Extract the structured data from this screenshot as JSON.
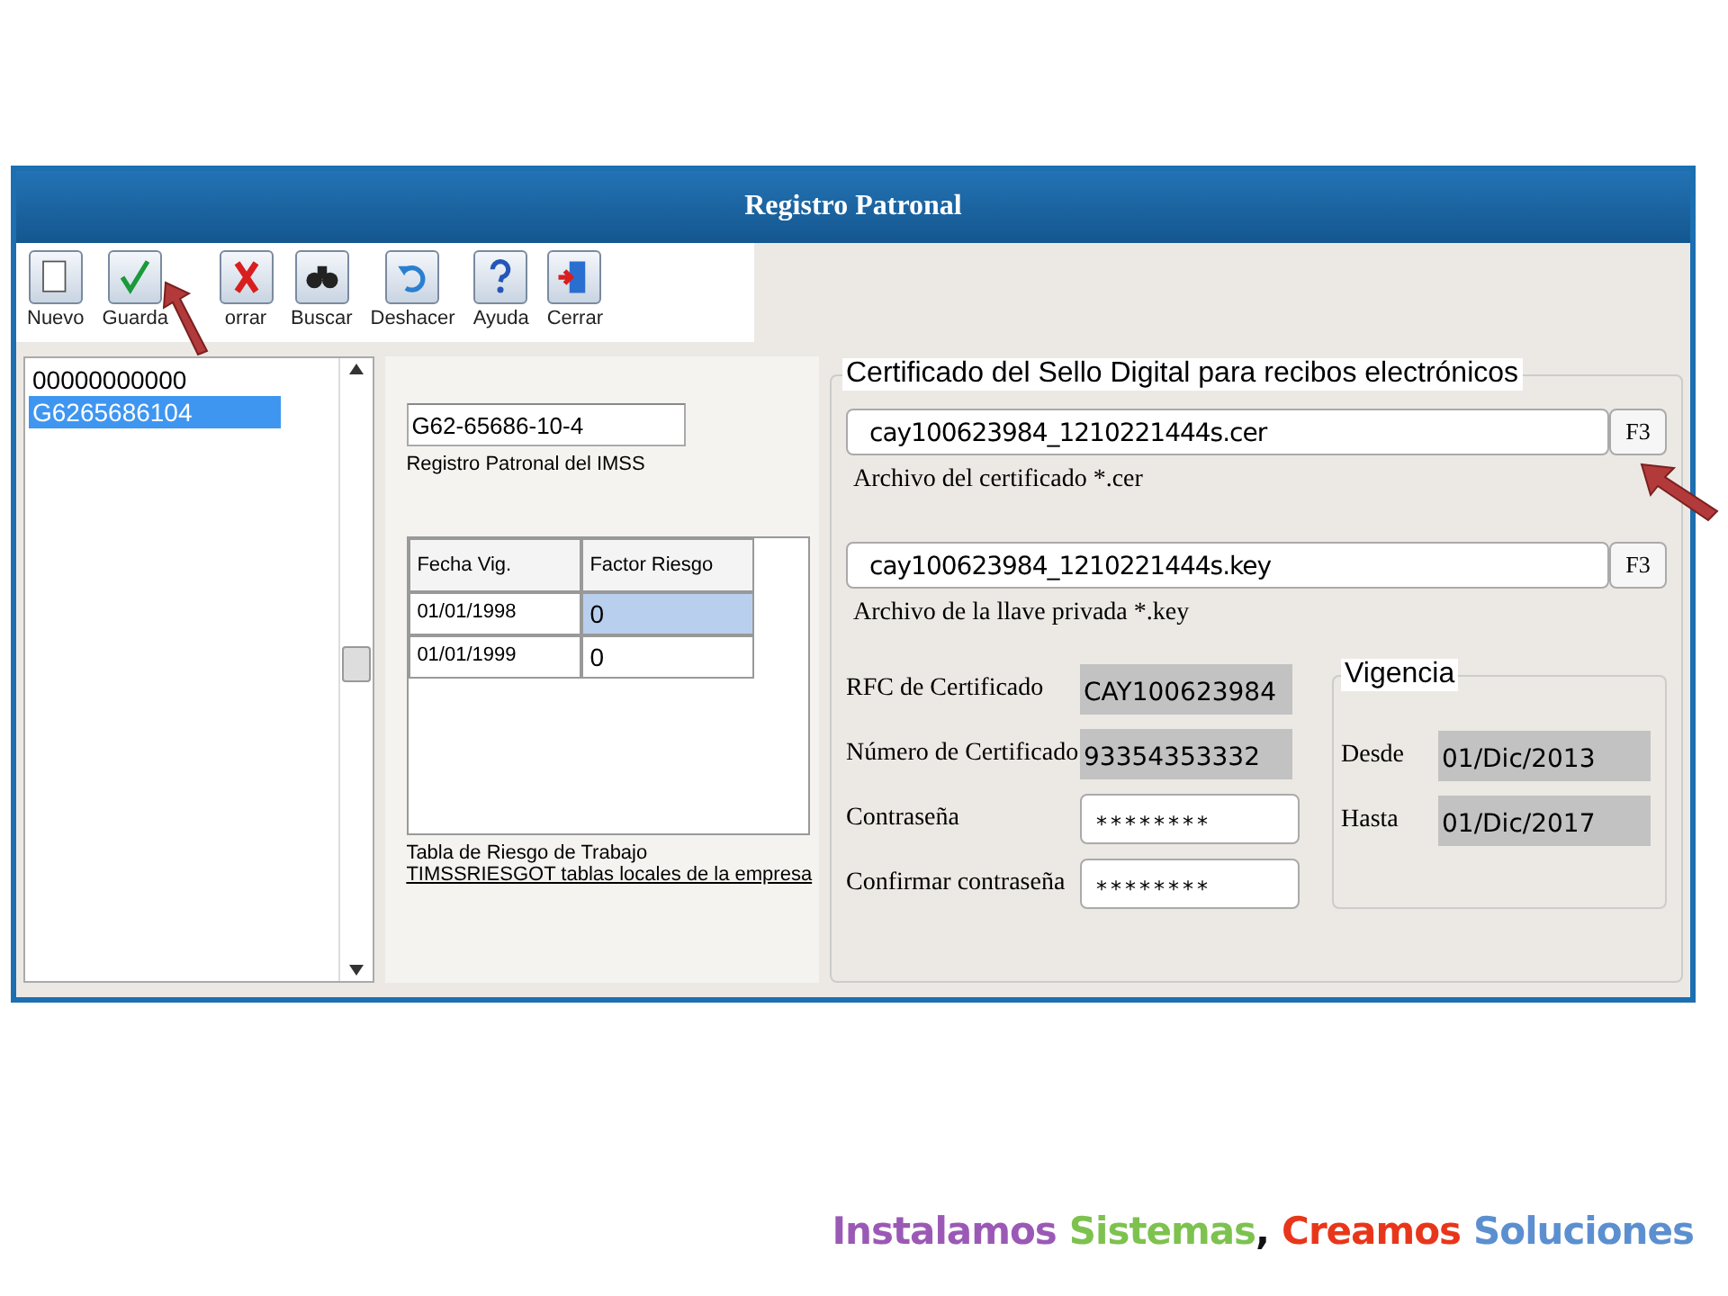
{
  "window": {
    "title": "Registro Patronal"
  },
  "toolbar": [
    {
      "label": "Nuevo"
    },
    {
      "label": "Guarda"
    },
    {
      "label": "orrar"
    },
    {
      "label": "Buscar"
    },
    {
      "label": "Deshacer"
    },
    {
      "label": "Ayuda"
    },
    {
      "label": "Cerrar"
    }
  ],
  "registry_list": {
    "items": [
      {
        "text": "00000000000",
        "selected": false
      },
      {
        "text": "G6265686104",
        "selected": true
      }
    ]
  },
  "registro": {
    "value": "G62-65686-10-4",
    "label": "Registro Patronal del IMSS"
  },
  "risk_table": {
    "columns": [
      "Fecha Vig.",
      "Factor Riesgo"
    ],
    "rows": [
      {
        "cells": [
          "01/01/1998",
          "0"
        ],
        "selected": true
      },
      {
        "cells": [
          "01/01/1999",
          "0"
        ],
        "selected": false
      }
    ],
    "caption": "Tabla de Riesgo de Trabajo",
    "link": "TIMSSRIESGOT tablas locales de la empresa"
  },
  "certificate": {
    "title": "Certificado del Sello Digital para recibos electrónicos",
    "files": [
      {
        "value": "cay100623984_1210221444s.cer",
        "button": "F3",
        "label": "Archivo del certificado *.cer"
      },
      {
        "value": "cay100623984_1210221444s.key",
        "button": "F3",
        "label": "Archivo de la llave privada  *.key"
      }
    ],
    "info": [
      {
        "label": "RFC de Certificado",
        "value": "CAY100623984"
      },
      {
        "label": "Número de Certificado",
        "value": "93354353332"
      }
    ],
    "passwords": [
      {
        "label": "Contraseña",
        "value": "********"
      },
      {
        "label": "Confirmar contraseña",
        "value": "********"
      }
    ],
    "vigencia": {
      "title": "Vigencia",
      "rows": [
        {
          "label": "Desde",
          "value": "01/Dic/2013"
        },
        {
          "label": "Hasta",
          "value": "01/Dic/2017"
        }
      ]
    }
  },
  "slogan": [
    {
      "text": "Instalamos",
      "color": "#9b59b6"
    },
    {
      "text": "Sistemas",
      "color": "#7dc24f"
    },
    {
      "text": ",",
      "color": "#111111"
    },
    {
      "text": "Creamos",
      "color": "#e8361a"
    },
    {
      "text": "Soluciones",
      "color": "#5b8fd0"
    }
  ]
}
